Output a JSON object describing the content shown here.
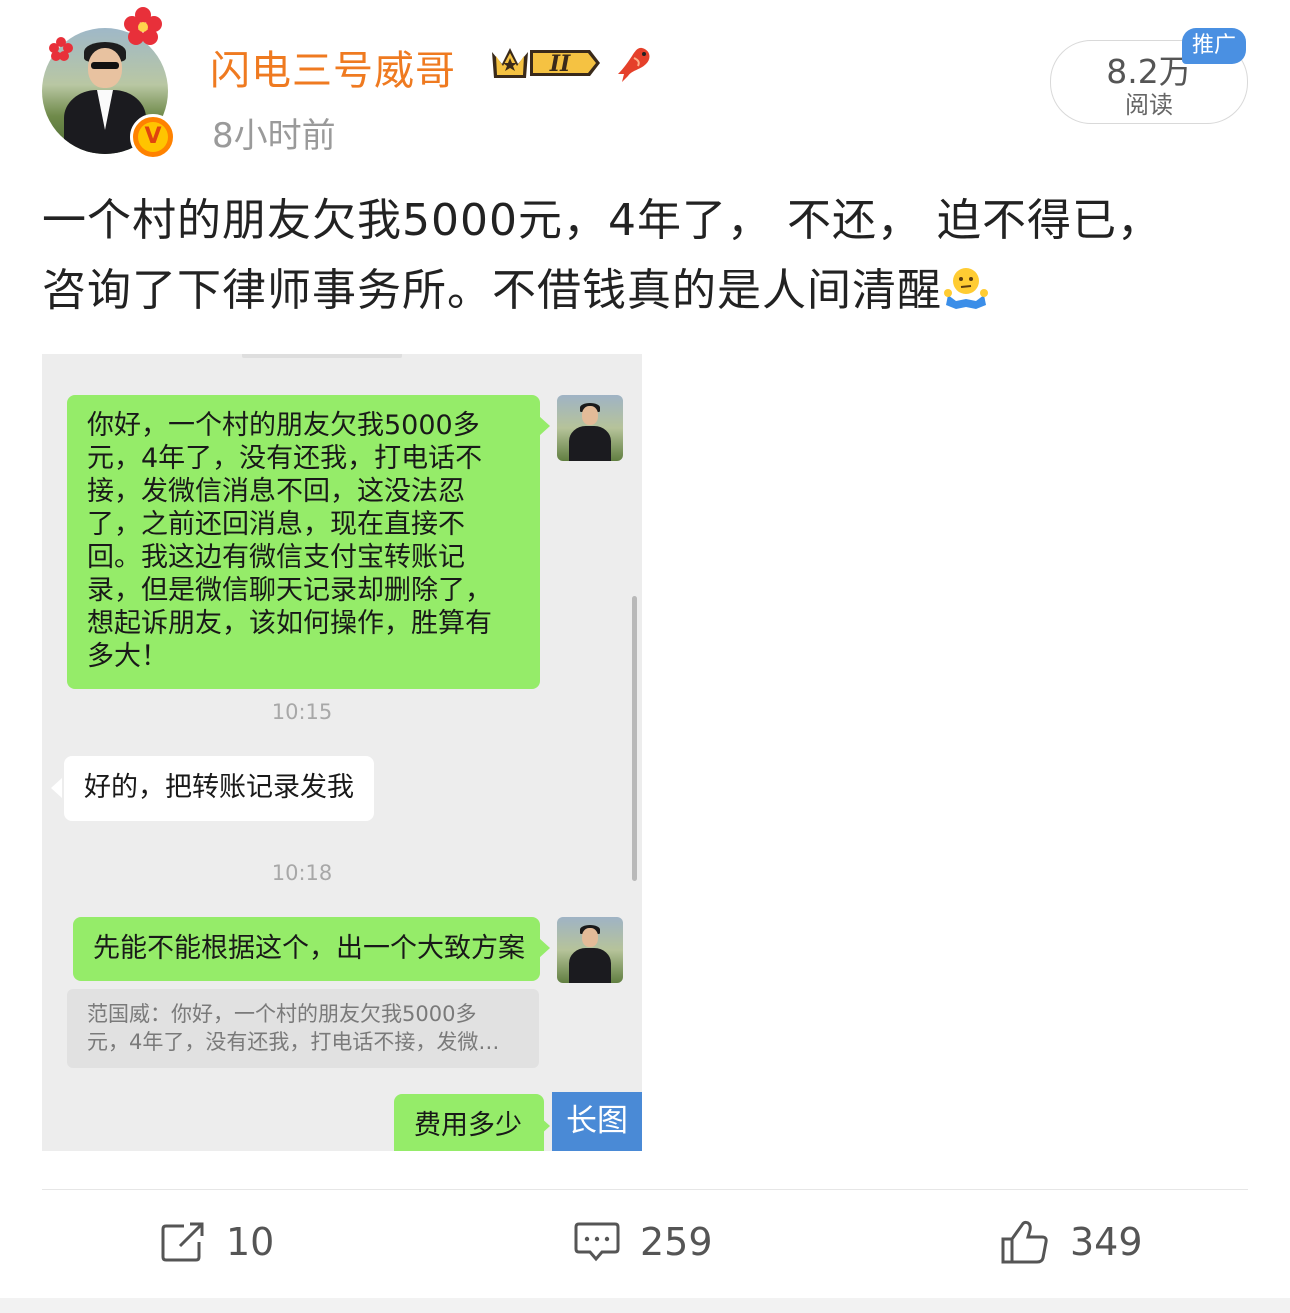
{
  "post": {
    "username": "闪电三号威哥",
    "time_ago": "8小时前",
    "level_badge": "II",
    "reads_count": "8.2万",
    "reads_label": "阅读",
    "promo_tag": "推广",
    "text_line1": "一个村的朋友欠我5000元，4年了， 不还， 迫不得已，",
    "text_line2": "咨询了下律师事务所。不借钱真的是人间清醒"
  },
  "chat": {
    "msg1": "你好，一个村的朋友欠我5000多元，4年了，没有还我，打电话不接，发微信消息不回，这没法忍了，之前还回消息，现在直接不回。我这边有微信支付宝转账记录，但是微信聊天记录却删除了，想起诉朋友，该如何操作，胜算有多大！",
    "time1": "10:15",
    "reply1": "好的，把转账记录发我",
    "time2": "10:18",
    "msg2": "先能不能根据这个，出一个大致方案",
    "quote_line1": "范国威：你好，一个村的朋友欠我5000多",
    "quote_line2": "元，4年了，没有还我，打电话不接，发微…",
    "msg3": "费用多少",
    "long_image_tag": "长图"
  },
  "actions": {
    "repost_count": "10",
    "comment_count": "259",
    "like_count": "349"
  },
  "colors": {
    "username": "#ef7a20",
    "wechat_green": "#95ec69",
    "long_image_blue": "#4a8ad6",
    "verified_orange": "#ff8200"
  },
  "icons": [
    "avatar",
    "red-flower-icon",
    "verified-v-icon",
    "crown-level-icon",
    "koi-fish-icon",
    "shrug-emoji-icon",
    "repost-icon",
    "comment-icon",
    "like-icon"
  ]
}
